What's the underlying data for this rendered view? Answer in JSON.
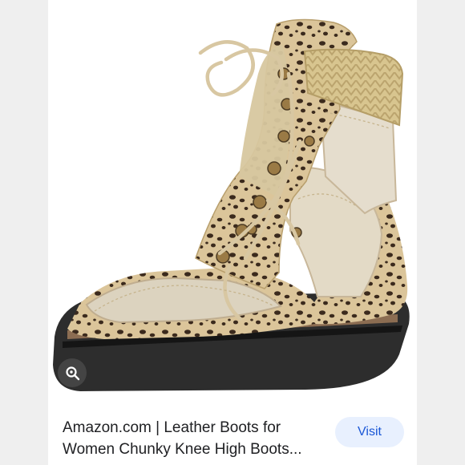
{
  "result": {
    "caption_line1": "Amazon.com | Leather Boots for",
    "caption_line2": "Women Chunky Knee High Boots...",
    "visit_label": "Visit"
  },
  "icons": {
    "lens": "lens-icon",
    "product": "boot-image"
  },
  "colors": {
    "page_bg": "#efefef",
    "card_bg": "#ffffff",
    "button_bg": "#e8f0fe",
    "button_text": "#1a57d6",
    "caption_text": "#202124"
  }
}
